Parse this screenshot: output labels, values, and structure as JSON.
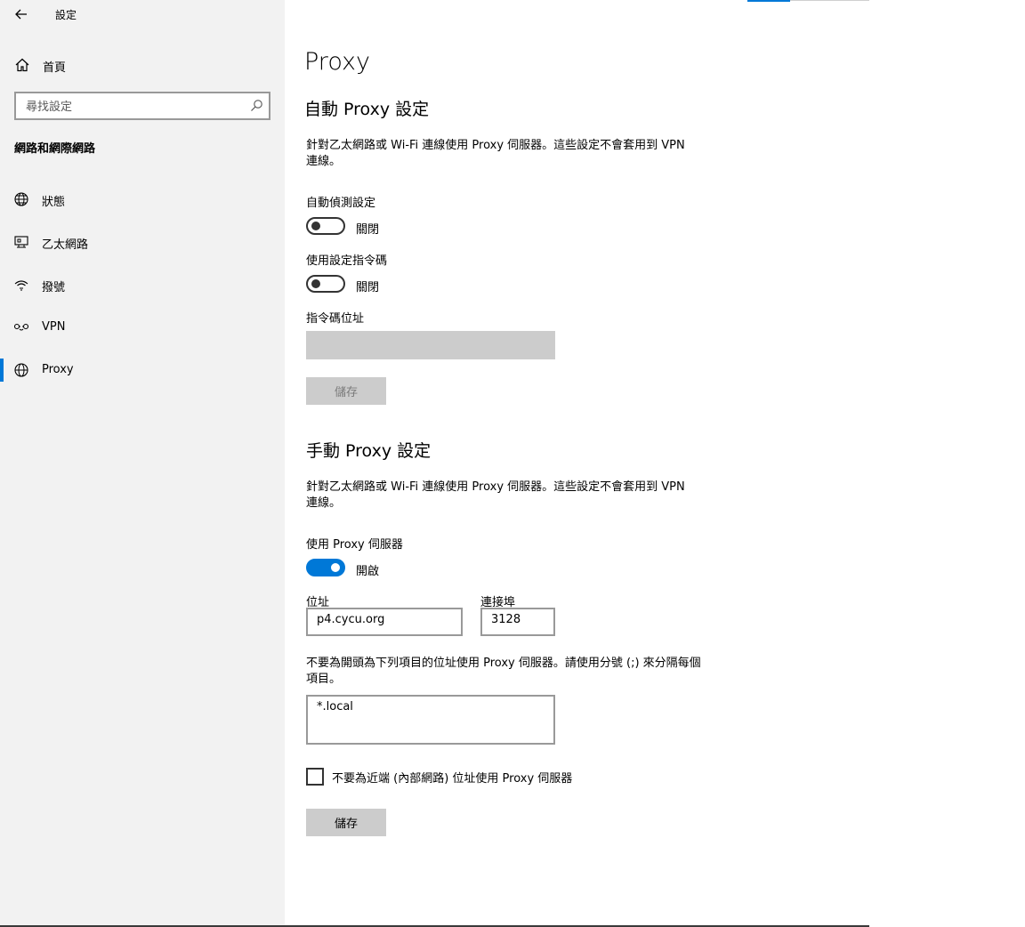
{
  "window": {
    "title": "設定"
  },
  "sidebar": {
    "home_label": "首頁",
    "search_placeholder": "尋找設定",
    "section_heading": "網路和網際網路",
    "items": [
      {
        "label": "狀態",
        "icon": "globe-status-icon"
      },
      {
        "label": "乙太網路",
        "icon": "ethernet-icon"
      },
      {
        "label": "撥號",
        "icon": "dialup-icon"
      },
      {
        "label": "VPN",
        "icon": "vpn-icon"
      },
      {
        "label": "Proxy",
        "icon": "globe-icon",
        "selected": true
      }
    ]
  },
  "main": {
    "page_title": "Proxy",
    "auto": {
      "heading": "自動 Proxy 設定",
      "description": "針對乙太網路或 Wi-Fi 連線使用 Proxy 伺服器。這些設定不會套用到 VPN 連線。",
      "detect_label": "自動偵測設定",
      "detect_state": "關閉",
      "detect_on": false,
      "script_label": "使用設定指令碼",
      "script_state": "關閉",
      "script_on": false,
      "address_label": "指令碼位址",
      "address_value": "",
      "save_label": "儲存"
    },
    "manual": {
      "heading": "手動 Proxy 設定",
      "description": "針對乙太網路或 Wi-Fi 連線使用 Proxy 伺服器。這些設定不會套用到 VPN 連線。",
      "use_proxy_label": "使用 Proxy 伺服器",
      "use_proxy_state": "開啟",
      "use_proxy_on": true,
      "address_label": "位址",
      "address_value": "p4.cycu.org",
      "port_label": "連接埠",
      "port_value": "3128",
      "exceptions_description": "不要為開頭為下列項目的位址使用 Proxy 伺服器。請使用分號 (;) 來分隔每個項目。",
      "exceptions_value": "*.local",
      "bypass_local_label": "不要為近端 (內部網路) 位址使用 Proxy 伺服器",
      "bypass_local_checked": false,
      "save_label": "儲存"
    }
  },
  "colors": {
    "accent": "#0078d7",
    "sidebar_bg": "#f2f2f2",
    "button_bg": "#cccccc"
  }
}
